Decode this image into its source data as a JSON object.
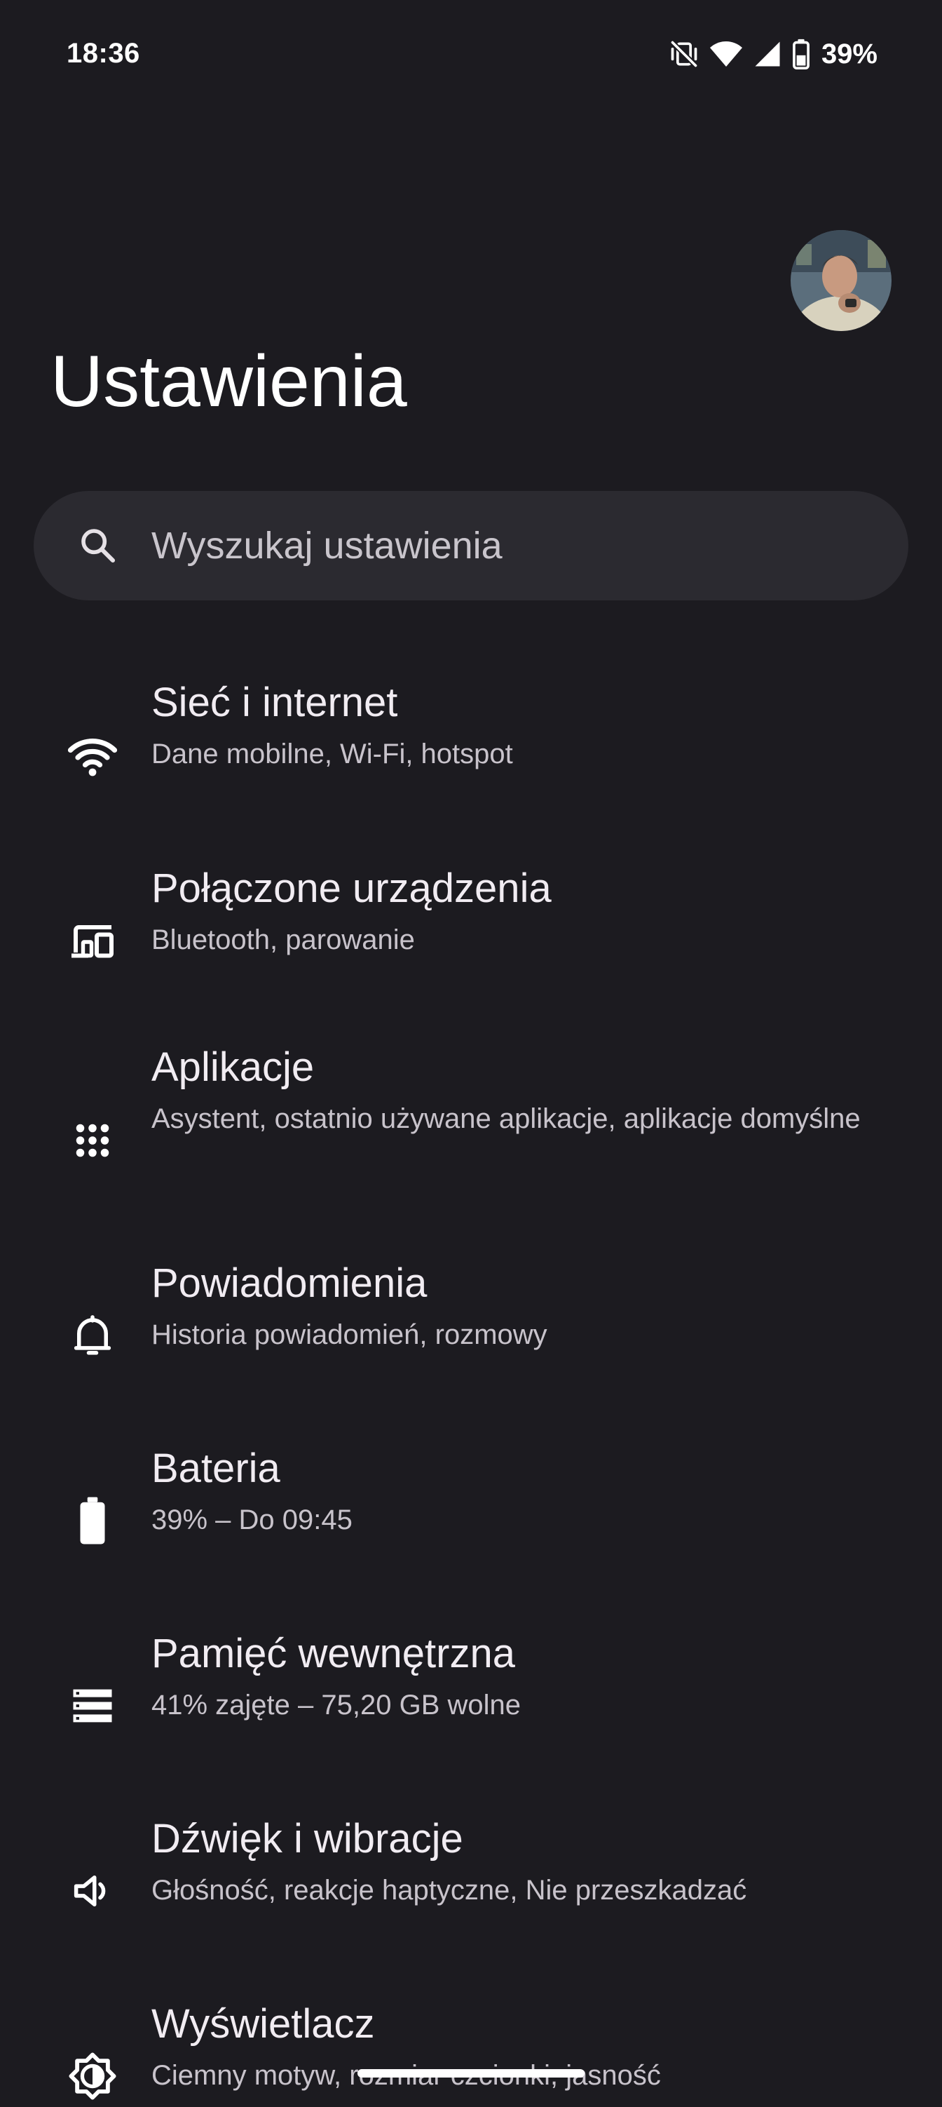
{
  "status_bar": {
    "time": "18:36",
    "battery_percent": "39%",
    "icons": [
      "vibrate-off-icon",
      "wifi-icon",
      "cell-signal-icon",
      "battery-icon"
    ]
  },
  "header": {
    "title": "Ustawienia",
    "avatar": "user-avatar"
  },
  "search": {
    "placeholder": "Wyszukaj ustawienia",
    "icon": "search-icon"
  },
  "settings": [
    {
      "icon": "wifi-icon",
      "title": "Sieć i internet",
      "subtitle": "Dane mobilne, Wi-Fi, hotspot"
    },
    {
      "icon": "connected-devices-icon",
      "title": "Połączone urządzenia",
      "subtitle": "Bluetooth, parowanie"
    },
    {
      "icon": "apps-grid-icon",
      "title": "Aplikacje",
      "subtitle": "Asystent, ostatnio używane aplikacje, aplikacje domyślne"
    },
    {
      "icon": "bell-icon",
      "title": "Powiadomienia",
      "subtitle": "Historia powiadomień, rozmowy"
    },
    {
      "icon": "battery-icon",
      "title": "Bateria",
      "subtitle": "39% – Do 09:45"
    },
    {
      "icon": "storage-icon",
      "title": "Pamięć wewnętrzna",
      "subtitle": "41% zajęte – 75,20 GB wolne"
    },
    {
      "icon": "volume-icon",
      "title": "Dźwięk i wibracje",
      "subtitle": "Głośność, reakcje haptyczne, Nie przeszkadzać"
    },
    {
      "icon": "display-brightness-icon",
      "title": "Wyświetlacz",
      "subtitle": "Ciemny motyw, rozmiar czcionki, jasność"
    }
  ],
  "colors": {
    "background": "#1c1b20",
    "search_background": "#2b2a30",
    "title_text": "#ffffff",
    "item_title": "#f1ecf2",
    "item_subtitle": "#c8c3cb"
  }
}
